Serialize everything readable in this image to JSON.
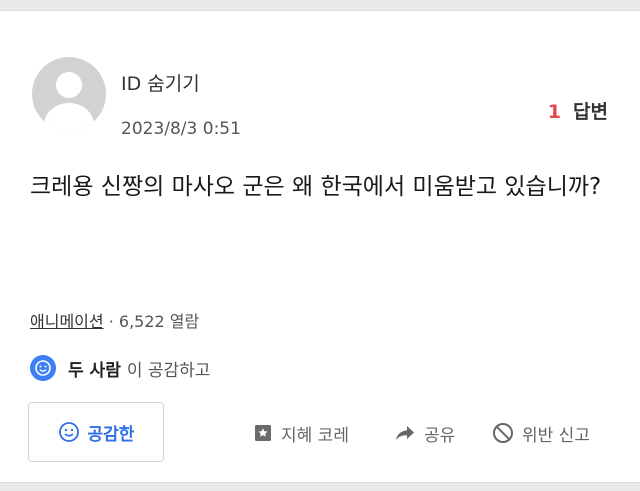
{
  "user": {
    "name": "ID 숨기기",
    "date": "2023/8/3 0:51"
  },
  "answers": {
    "count": "1",
    "label": "답변"
  },
  "question": {
    "text": "크레용 신짱의 마사오 군은 왜 한국에서 미움받고 있습니까?"
  },
  "meta": {
    "category": "애니메이션",
    "separator": "·",
    "views": "6,522 열람"
  },
  "empathy": {
    "who": "두 사람",
    "suffix": "이 공감하고"
  },
  "actions": {
    "empathize_label": "공감한",
    "wisdom_label": "지혜 코레",
    "share_label": "공유",
    "report_label": "위반 신고"
  },
  "colors": {
    "accent": "#3b7ef6",
    "answer_count": "#e5484d",
    "button_text": "#2f6fe8"
  },
  "icons": [
    "avatar-default-icon",
    "smile-icon",
    "bookmark-icon",
    "share-arrow-icon",
    "prohibit-icon"
  ]
}
